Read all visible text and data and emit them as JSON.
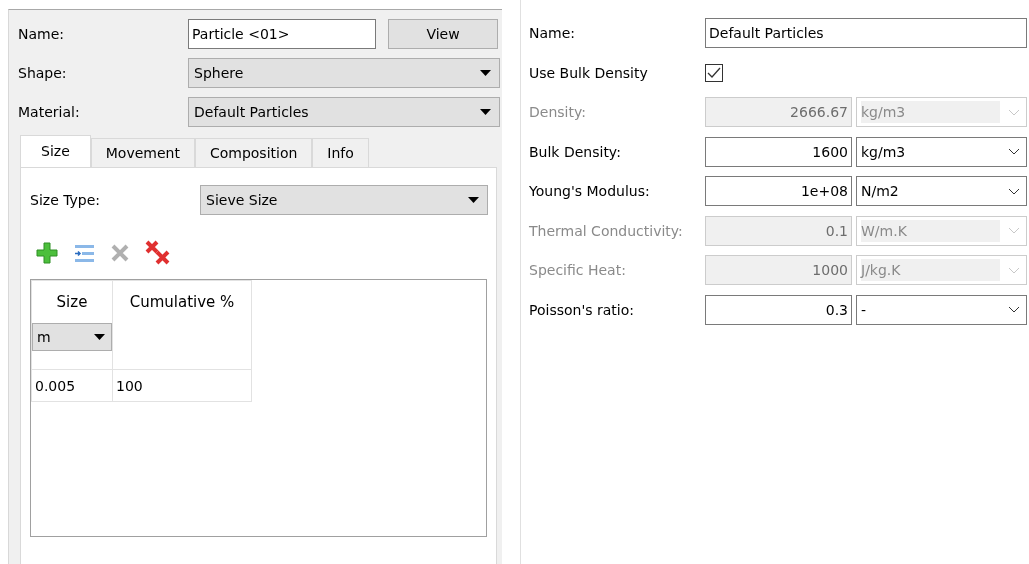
{
  "particle": {
    "name_label": "Name:",
    "name_value": "Particle <01>",
    "view_button": "View",
    "shape": {
      "label": "Shape:",
      "value": "Sphere"
    },
    "material": {
      "label": "Material:",
      "value": "Default Particles"
    },
    "tabs": [
      {
        "label": "Size",
        "selected": true
      },
      {
        "label": "Movement",
        "selected": false
      },
      {
        "label": "Composition",
        "selected": false
      },
      {
        "label": "Info",
        "selected": false
      }
    ],
    "size_type": {
      "label": "Size Type:",
      "value": "Sieve Size"
    },
    "table": {
      "columns": [
        {
          "label": "Size",
          "unit": "m"
        },
        {
          "label": "Cumulative %"
        }
      ],
      "rows": [
        [
          "0.005",
          "100"
        ]
      ]
    }
  },
  "material": {
    "name_label": "Name:",
    "name_value": "Default Particles",
    "use_bulk": {
      "label": "Use Bulk Density",
      "checked": true
    },
    "properties": [
      {
        "label": "Density:",
        "value": "2666.67",
        "unit": "kg/m3",
        "disabled": true
      },
      {
        "label": "Bulk Density:",
        "value": "1600",
        "unit": "kg/m3",
        "disabled": false
      },
      {
        "label": "Young's Modulus:",
        "value": "1e+08",
        "unit": "N/m2",
        "disabled": false
      },
      {
        "label": "Thermal Conductivity:",
        "value": "0.1",
        "unit": "W/m.K",
        "disabled": true
      },
      {
        "label": "Specific Heat:",
        "value": "1000",
        "unit": "J/kg.K",
        "disabled": true
      },
      {
        "label": "Poisson's ratio:",
        "value": "0.3",
        "unit": "-",
        "disabled": false
      }
    ]
  }
}
